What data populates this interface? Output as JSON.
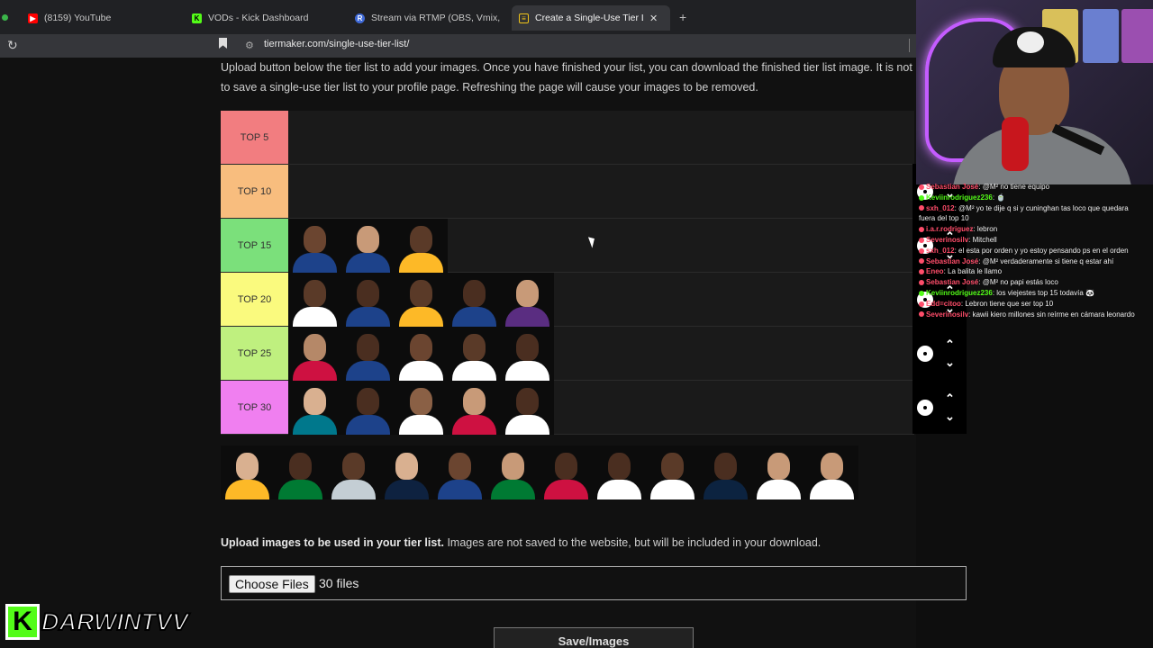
{
  "browser": {
    "tabs": [
      {
        "label": "(8159) YouTube",
        "icon": "youtube-icon",
        "color": "#ff0000"
      },
      {
        "label": "VODs - Kick Dashboard",
        "icon": "kick-icon",
        "color": "#53fc18"
      },
      {
        "label": "Stream via RTMP (OBS, Vmix, Zoo",
        "icon": "restream-icon",
        "color": "#3f6ad8"
      },
      {
        "label": "Create a Single-Use Tier List (",
        "icon": "tiermaker-icon",
        "color": "#f0c419"
      }
    ],
    "active_tab_index": 3,
    "url": "tiermaker.com/single-use-tier-list/"
  },
  "page": {
    "intro_line1": "Upload button below the tier list to add your images. Once you have finished your list, you can download the finished tier list image. It is not possible",
    "intro_line2": "to save a single-use tier list to your profile page. Refreshing the page will cause your images to be removed.",
    "tiers": [
      {
        "label": "TOP 5",
        "color": "#f27d80",
        "players": []
      },
      {
        "label": "TOP 10",
        "color": "#f8bd7e",
        "players": []
      },
      {
        "label": "TOP 15",
        "color": "#7be07b",
        "players": [
          {
            "skin": "#6b4530",
            "jersey": "#1d428a"
          },
          {
            "skin": "#c89a78",
            "jersey": "#1d428a"
          },
          {
            "skin": "#5a3a28",
            "jersey": "#fdb927"
          }
        ]
      },
      {
        "label": "TOP 20",
        "color": "#fafa7e",
        "players": [
          {
            "skin": "#5a3a28",
            "jersey": "#ffffff"
          },
          {
            "skin": "#4a2e20",
            "jersey": "#1d428a"
          },
          {
            "skin": "#5a3a28",
            "jersey": "#fdb927"
          },
          {
            "skin": "#4a2e20",
            "jersey": "#1d428a"
          },
          {
            "skin": "#c89a78",
            "jersey": "#5a2d81"
          }
        ]
      },
      {
        "label": "TOP 25",
        "color": "#bff07f",
        "players": [
          {
            "skin": "#b58868",
            "jersey": "#ce1141"
          },
          {
            "skin": "#4a2e20",
            "jersey": "#1d428a"
          },
          {
            "skin": "#6b4530",
            "jersey": "#ffffff"
          },
          {
            "skin": "#5a3a28",
            "jersey": "#ffffff"
          },
          {
            "skin": "#4a2e20",
            "jersey": "#ffffff"
          }
        ]
      },
      {
        "label": "TOP 30",
        "color": "#f07ff0",
        "players": [
          {
            "skin": "#d9b090",
            "jersey": "#00788c"
          },
          {
            "skin": "#4a2e20",
            "jersey": "#1d428a"
          },
          {
            "skin": "#8a6045",
            "jersey": "#ffffff"
          },
          {
            "skin": "#c89a78",
            "jersey": "#ce1141"
          },
          {
            "skin": "#4a2e20",
            "jersey": "#ffffff"
          }
        ]
      }
    ],
    "pool": [
      {
        "skin": "#d9b090",
        "jersey": "#fdb927"
      },
      {
        "skin": "#4a2e20",
        "jersey": "#007a33"
      },
      {
        "skin": "#5a3a28",
        "jersey": "#c4ced4"
      },
      {
        "skin": "#d9b090",
        "jersey": "#0e2240"
      },
      {
        "skin": "#6b4530",
        "jersey": "#1d428a"
      },
      {
        "skin": "#c89a78",
        "jersey": "#007a33"
      },
      {
        "skin": "#4a2e20",
        "jersey": "#ce1141"
      },
      {
        "skin": "#4a2e20",
        "jersey": "#ffffff"
      },
      {
        "skin": "#5a3a28",
        "jersey": "#ffffff"
      },
      {
        "skin": "#4a2e20",
        "jersey": "#0c2340"
      },
      {
        "skin": "#c89a78",
        "jersey": "#ffffff"
      },
      {
        "skin": "#c89a78",
        "jersey": "#ffffff"
      }
    ],
    "upload_bold": "Upload images to be used in your tier list.",
    "upload_rest": " Images are not saved to the website, but will be included in your download.",
    "choose_files_label": "Choose Files",
    "file_count": "30 files",
    "save_label": "Save/Images"
  },
  "chat": [
    {
      "user": "Sebastian José",
      "user_color": "#ff4d6a",
      "text": ": @M² no tiene equipo"
    },
    {
      "user": "Keviinrodriguez236",
      "user_color": "#53fc18",
      "text": ": 🍵"
    },
    {
      "user": "sxh_012",
      "user_color": "#ff4d6a",
      "text": ": @M² yo te dije q si y cuninghan tas loco que quedara fuera del top 10"
    },
    {
      "user": "i.a.r.rodriguez",
      "user_color": "#ff4d6a",
      "text": ": lebron"
    },
    {
      "user": "Severinosilv",
      "user_color": "#ff4d6a",
      "text": ": Mitchell"
    },
    {
      "user": "sxh_012",
      "user_color": "#ff4d6a",
      "text": ": el esta por orden y yo estoy pensando ps en el orden"
    },
    {
      "user": "Sebastian José",
      "user_color": "#ff4d6a",
      "text": ": @M² verdaderamente si tiene q estar ahí"
    },
    {
      "user": "Eneo",
      "user_color": "#ff4d6a",
      "text": ": La balita le llamo"
    },
    {
      "user": "Sebastian José",
      "user_color": "#ff4d6a",
      "text": ": @M² no papi estás loco"
    },
    {
      "user": "Keviinrodriguez236",
      "user_color": "#53fc18",
      "text": ": los viejestes top 15 todavía 🐼"
    },
    {
      "user": "Edd=citoo",
      "user_color": "#ff4d6a",
      "text": ": Lebron tiene que ser top 10"
    },
    {
      "user": "Severinosilv",
      "user_color": "#ff4d6a",
      "text": ": kawii kiero millones sin reírme en cámara leonardo"
    }
  ],
  "streamer": {
    "name": "DARWINTVV",
    "brand_color": "#53fc18"
  }
}
